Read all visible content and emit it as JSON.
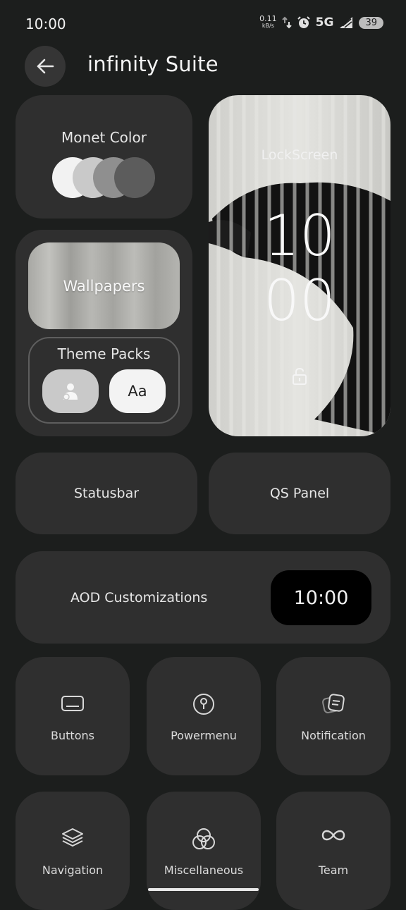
{
  "status_bar": {
    "time": "10:00",
    "speed_value": "0.11",
    "speed_unit": "kB/s",
    "network": "5G",
    "battery": "39"
  },
  "header": {
    "title": "infinity Suite"
  },
  "monet": {
    "label": "Monet Color",
    "swatches": [
      "#f2f2f2",
      "#c9c9c9",
      "#8f8f8f",
      "#5c5c5c"
    ]
  },
  "wallpapers": {
    "label": "Wallpapers"
  },
  "theme_packs": {
    "label": "Theme Packs",
    "font_button_label": "Aa"
  },
  "lockscreen": {
    "label": "LockScreen",
    "clock_hour": "10",
    "clock_minute": "00"
  },
  "statusbar": {
    "label": "Statusbar"
  },
  "qs_panel": {
    "label": "QS Panel"
  },
  "aod": {
    "label": "AOD Customizations",
    "clock": "10:00"
  },
  "tiles": [
    {
      "label": "Buttons",
      "icon": "button-icon"
    },
    {
      "label": "Powermenu",
      "icon": "power-icon"
    },
    {
      "label": "Notification",
      "icon": "notification-icon"
    },
    {
      "label": "Navigation",
      "icon": "layers-icon"
    },
    {
      "label": "Miscellaneous",
      "icon": "circles-icon"
    },
    {
      "label": "Team",
      "icon": "infinity-icon"
    }
  ]
}
